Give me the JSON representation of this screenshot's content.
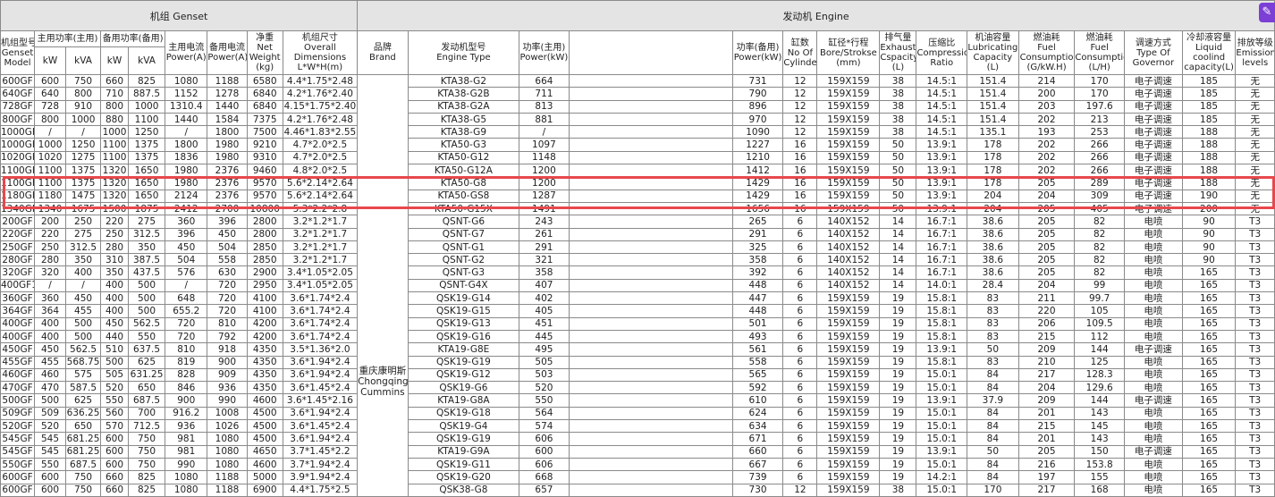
{
  "genset_group": "机组  Genset",
  "engine_group": "发动机  Engine",
  "brand_label": "重庆康明斯\nChongqing\nCummins",
  "headers": {
    "model": "机组型号\nGenset\nModel",
    "prime": "主用功率(主用)",
    "standby": "备用功率(备用)",
    "prime_current": "主用电流\nPower(A)",
    "standby_current": "备用电流\nPower(A)",
    "weight": "净重\nNet\nWeight\n(kg)",
    "dims": "机组尺寸\nOverall\nDimensions\nL*W*H(m)",
    "brand": "品牌\nBrand",
    "engine_type": "发动机型号\nEngine Type",
    "engine_prime": "功率(主用)\nPower(kW)",
    "engine_standby": "功率(备用)\nPower(kW)",
    "cylinders": "缸数\nNo Of\nCylinders",
    "bore": "缸径*行程\nBore/Strokse\n(mm)",
    "exhaust": "排气量\nExhaust\nCspacity\n(L)",
    "compression": "压缩比\nCompression\nRatio",
    "lube": "机油容量\nLubricating\nCapacity\n(L)",
    "fuel_gkwh": "燃油耗\nFuel\nConsumptio\n(G/kW.H)",
    "fuel_lh": "燃油耗\nFuel\nConsumptio\n(L/H)",
    "governor": "调速方式\nType Of\nGovernor",
    "coolant": "冷却液容量\nLiquid\ncoolind\ncapacity(L)",
    "emission": "排放等级\nEmission\nlevels",
    "unit_kw": "kW",
    "unit_kva": "kVA"
  },
  "rows": [
    [
      "600GF",
      "600",
      "750",
      "660",
      "825",
      "1080",
      "1188",
      "6580",
      "4.4*1.75*2.48",
      "KTA38-G2",
      "664",
      "731",
      "12",
      "159X159",
      "38",
      "14.5:1",
      "151.4",
      "214",
      "170",
      "电子调速",
      "185",
      "无"
    ],
    [
      "640GF",
      "640",
      "800",
      "710",
      "887.5",
      "1152",
      "1278",
      "6840",
      "4.2*1.76*2.40",
      "KTA38-G2B",
      "711",
      "790",
      "12",
      "159X159",
      "38",
      "14.5:1",
      "151.4",
      "200",
      "170",
      "电子调速",
      "185",
      "无"
    ],
    [
      "728GF",
      "728",
      "910",
      "800",
      "1000",
      "1310.4",
      "1440",
      "6840",
      "4.15*1.75*2.40",
      "KTA38-G2A",
      "813",
      "896",
      "12",
      "159X159",
      "38",
      "14.5:1",
      "151.4",
      "203",
      "197.6",
      "电子调速",
      "185",
      "无"
    ],
    [
      "800GF",
      "800",
      "1000",
      "880",
      "1100",
      "1440",
      "1584",
      "7375",
      "4.2*1.76*2.48",
      "KTA38-G5",
      "881",
      "970",
      "12",
      "159X159",
      "38",
      "14.5:1",
      "151.4",
      "202",
      "213",
      "电子调速",
      "185",
      "无"
    ],
    [
      "1000GF1",
      "/",
      "/",
      "1000",
      "1250",
      "/",
      "1800",
      "7500",
      "4.46*1.83*2.55",
      "KTA38-G9",
      "/",
      "1090",
      "12",
      "159X159",
      "38",
      "14.5:1",
      "135.1",
      "193",
      "253",
      "电子调速",
      "188",
      "无"
    ],
    [
      "1000GF",
      "1000",
      "1250",
      "1100",
      "1375",
      "1800",
      "1980",
      "9210",
      "4.7*2.0*2.5",
      "KTA50-G3",
      "1097",
      "1227",
      "16",
      "159X159",
      "50",
      "13.9:1",
      "178",
      "202",
      "266",
      "电子调速",
      "188",
      "无"
    ],
    [
      "1020GF",
      "1020",
      "1275",
      "1100",
      "1375",
      "1836",
      "1980",
      "9310",
      "4.7*2.0*2.5",
      "KTA50-G12",
      "1148",
      "1210",
      "16",
      "159X159",
      "50",
      "13.9:1",
      "178",
      "202",
      "266",
      "电子调速",
      "188",
      "无"
    ],
    [
      "1100GF",
      "1100",
      "1375",
      "1320",
      "1650",
      "1980",
      "2376",
      "9460",
      "4.8*2.0*2.5",
      "KTA50-G12A",
      "1200",
      "1412",
      "16",
      "159X159",
      "50",
      "13.9:1",
      "178",
      "202",
      "266",
      "电子调速",
      "188",
      "无"
    ],
    [
      "1100GF",
      "1100",
      "1375",
      "1320",
      "1650",
      "1980",
      "2376",
      "9570",
      "5.6*2.14*2.64",
      "KTA50-G8",
      "1200",
      "1429",
      "16",
      "159X159",
      "50",
      "13.9:1",
      "178",
      "205",
      "289",
      "电子调速",
      "188",
      "无"
    ],
    [
      "1180GF",
      "1180",
      "1475",
      "1320",
      "1650",
      "2124",
      "2376",
      "9570",
      "5.6*2.14*2.64",
      "KTA50-GS8",
      "1287",
      "1429",
      "16",
      "159X159",
      "50",
      "13.9:1",
      "204",
      "204",
      "309",
      "电子调速",
      "190",
      "无"
    ],
    [
      "1340GF",
      "1340",
      "1675",
      "1500",
      "1875",
      "2412",
      "2700",
      "10800",
      "5.3*2.2*2.8",
      "KTA50-G15X",
      "1491",
      "1656",
      "16",
      "159X159",
      "50",
      "13.9:1",
      "204",
      "205",
      "405",
      "电子调速",
      "200",
      "无"
    ],
    [
      "200GF",
      "200",
      "250",
      "220",
      "275",
      "360",
      "396",
      "2800",
      "3.2*1.2*1.7",
      "QSNT-G6",
      "243",
      "265",
      "6",
      "140X152",
      "14",
      "16.7:1",
      "38.6",
      "205",
      "82",
      "电喷",
      "90",
      "T3"
    ],
    [
      "220GF",
      "220",
      "275",
      "250",
      "312.5",
      "396",
      "450",
      "2800",
      "3.2*1.2*1.7",
      "QSNT-G7",
      "261",
      "291",
      "6",
      "140X152",
      "14",
      "16.7:1",
      "38.6",
      "205",
      "82",
      "电喷",
      "90",
      "T3"
    ],
    [
      "250GF",
      "250",
      "312.5",
      "280",
      "350",
      "450",
      "504",
      "2850",
      "3.2*1.2*1.7",
      "QSNT-G1",
      "291",
      "325",
      "6",
      "140X152",
      "14",
      "16.7:1",
      "38.6",
      "205",
      "82",
      "电喷",
      "90",
      "T3"
    ],
    [
      "280GF",
      "280",
      "350",
      "310",
      "387.5",
      "504",
      "558",
      "2850",
      "3.2*1.2*1.7",
      "QSNT-G2",
      "321",
      "358",
      "6",
      "140X152",
      "14",
      "16.7:1",
      "38.6",
      "205",
      "82",
      "电喷",
      "90",
      "T3"
    ],
    [
      "320GF",
      "320",
      "400",
      "350",
      "437.5",
      "576",
      "630",
      "2900",
      "3.4*1.05*2.05",
      "QSNT-G3",
      "358",
      "392",
      "6",
      "140X152",
      "14",
      "16.7:1",
      "38.6",
      "205",
      "82",
      "电喷",
      "165",
      "T3"
    ],
    [
      "400GF1",
      "/",
      "/",
      "400",
      "500",
      "/",
      "720",
      "2950",
      "3.4*1.05*2.05",
      "QSNT-G4X",
      "407",
      "448",
      "6",
      "140X152",
      "14",
      "14.0:1",
      "28.4",
      "204",
      "99",
      "电喷",
      "165",
      "T3"
    ],
    [
      "360GF",
      "360",
      "450",
      "400",
      "500",
      "648",
      "720",
      "4100",
      "3.6*1.74*2.4",
      "QSK19-G14",
      "402",
      "447",
      "6",
      "159X159",
      "19",
      "15.8:1",
      "83",
      "211",
      "99.7",
      "电喷",
      "165",
      "T3"
    ],
    [
      "364GF",
      "364",
      "455",
      "400",
      "500",
      "655.2",
      "720",
      "4100",
      "3.6*1.74*2.4",
      "QSK19-G15",
      "405",
      "448",
      "6",
      "159X159",
      "19",
      "15.8:1",
      "83",
      "220",
      "105",
      "电喷",
      "165",
      "T3"
    ],
    [
      "400GF",
      "400",
      "500",
      "450",
      "562.5",
      "720",
      "810",
      "4200",
      "3.6*1.74*2.4",
      "QSK19-G13",
      "451",
      "501",
      "6",
      "159X159",
      "19",
      "15.8:1",
      "83",
      "206",
      "109.5",
      "电喷",
      "165",
      "T3"
    ],
    [
      "400GF",
      "400",
      "500",
      "440",
      "550",
      "720",
      "792",
      "4200",
      "3.6*1.74*2.4",
      "QSK19-G16",
      "445",
      "493",
      "6",
      "159X159",
      "19",
      "15.8:1",
      "83",
      "215",
      "112",
      "电喷",
      "165",
      "T3"
    ],
    [
      "450GF",
      "450",
      "562.5",
      "510",
      "637.5",
      "810",
      "918",
      "4350",
      "3.5*1.36*2.0",
      "KTA19-G8E",
      "495",
      "561",
      "6",
      "159X159",
      "19",
      "13.9:1",
      "50",
      "209",
      "144",
      "电子调速",
      "165",
      "T3"
    ],
    [
      "455GF",
      "455",
      "568.75",
      "500",
      "625",
      "819",
      "900",
      "4350",
      "3.6*1.94*2.4",
      "QSK19-G19",
      "505",
      "558",
      "6",
      "159X159",
      "19",
      "15.8:1",
      "83",
      "210",
      "125",
      "电喷",
      "165",
      "T3"
    ],
    [
      "460GF",
      "460",
      "575",
      "505",
      "631.25",
      "828",
      "909",
      "4350",
      "3.6*1.94*2.4",
      "QSK19-G12",
      "503",
      "565",
      "6",
      "159X159",
      "19",
      "15.0:1",
      "84",
      "217",
      "128.3",
      "电喷",
      "165",
      "T3"
    ],
    [
      "470GF",
      "470",
      "587.5",
      "520",
      "650",
      "846",
      "936",
      "4350",
      "3.6*1.45*2.4",
      "QSK19-G6",
      "520",
      "592",
      "6",
      "159X159",
      "19",
      "15.0:1",
      "84",
      "204",
      "129.6",
      "电喷",
      "165",
      "T3"
    ],
    [
      "500GF",
      "500",
      "625",
      "550",
      "687.5",
      "900",
      "990",
      "4600",
      "3.6*1.45*2.16",
      "KTA19-G8A",
      "550",
      "610",
      "6",
      "159X159",
      "19",
      "13.9:1",
      "37.9",
      "209",
      "144",
      "电子调速",
      "165",
      "T3"
    ],
    [
      "509GF",
      "509",
      "636.25",
      "560",
      "700",
      "916.2",
      "1008",
      "4500",
      "3.6*1.94*2.4",
      "QSK19-G18",
      "564",
      "624",
      "6",
      "159X159",
      "19",
      "15.0:1",
      "84",
      "201",
      "143",
      "电喷",
      "165",
      "T3"
    ],
    [
      "520GF",
      "520",
      "650",
      "570",
      "712.5",
      "936",
      "1026",
      "4500",
      "3.6*1.45*2.4",
      "QSK19-G4",
      "574",
      "634",
      "6",
      "159X159",
      "19",
      "15.0:1",
      "84",
      "215",
      "145",
      "电喷",
      "165",
      "T3"
    ],
    [
      "545GF",
      "545",
      "681.25",
      "600",
      "750",
      "981",
      "1080",
      "4500",
      "3.6*1.94*2.4",
      "QSK19-G19",
      "606",
      "671",
      "6",
      "159X159",
      "19",
      "15.0:1",
      "84",
      "201",
      "143",
      "电喷",
      "165",
      "T3"
    ],
    [
      "545GF",
      "545",
      "681.25",
      "600",
      "750",
      "981",
      "1080",
      "4650",
      "3.7*1.45*2.2",
      "KTA19-G9A",
      "600",
      "660",
      "6",
      "159X159",
      "19",
      "13.9:1",
      "50",
      "205",
      "150",
      "电子调速",
      "165",
      "T3"
    ],
    [
      "550GF",
      "550",
      "687.5",
      "600",
      "750",
      "990",
      "1080",
      "4600",
      "3.7*1.94*2.4",
      "QSK19-G11",
      "606",
      "667",
      "6",
      "159X159",
      "19",
      "15.0:1",
      "84",
      "216",
      "153.8",
      "电喷",
      "165",
      "T3"
    ],
    [
      "600GF",
      "600",
      "750",
      "660",
      "825",
      "1080",
      "1188",
      "5000",
      "3.9*1.94*2.4",
      "QSK19-G20",
      "668",
      "739",
      "6",
      "159X159",
      "19",
      "14.2:1",
      "84",
      "197",
      "155",
      "电喷",
      "165",
      "T3"
    ],
    [
      "600GF",
      "600",
      "750",
      "660",
      "825",
      "1080",
      "1188",
      "6900",
      "4.4*1.75*2.5",
      "QSK38-G8",
      "657",
      "730",
      "12",
      "159X159",
      "38",
      "15.0:1",
      "170",
      "217",
      "168",
      "电喷",
      "165",
      "T3"
    ]
  ],
  "accent": "#e8484d"
}
